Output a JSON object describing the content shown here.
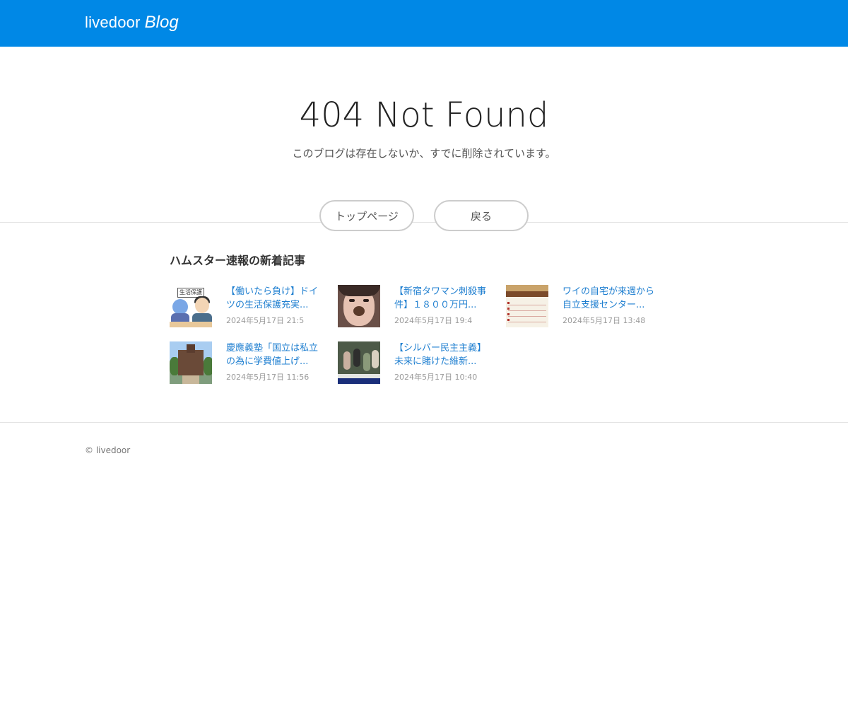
{
  "header": {
    "logo_main": "livedoor",
    "logo_blog": "Blog"
  },
  "error": {
    "title": "404 Not Found",
    "message": "このブログは存在しないか、すでに削除されています。",
    "top_button": "トップページ",
    "back_button": "戻る"
  },
  "recent": {
    "heading": "ハムスター速報の新着記事",
    "articles": [
      {
        "title": "【働いたら負け】ドイツの生活保護充実...",
        "date": "2024年5月17日 21:5",
        "thumb_label": "生活保護"
      },
      {
        "title": "【新宿タワマン刺殺事件】１８００万円...",
        "date": "2024年5月17日 19:4"
      },
      {
        "title": "ワイの自宅が来週から自立支援センター...",
        "date": "2024年5月17日 13:48"
      },
      {
        "title": "慶應義塾「国立は私立の為に学費値上げ...",
        "date": "2024年5月17日 11:56"
      },
      {
        "title": "【シルバー民主主義】未来に賭けた維新...",
        "date": "2024年5月17日 10:40"
      }
    ]
  },
  "footer": {
    "copyright": "© livedoor"
  },
  "colors": {
    "header_bg": "#0088e6",
    "link": "#1f7fd0"
  }
}
